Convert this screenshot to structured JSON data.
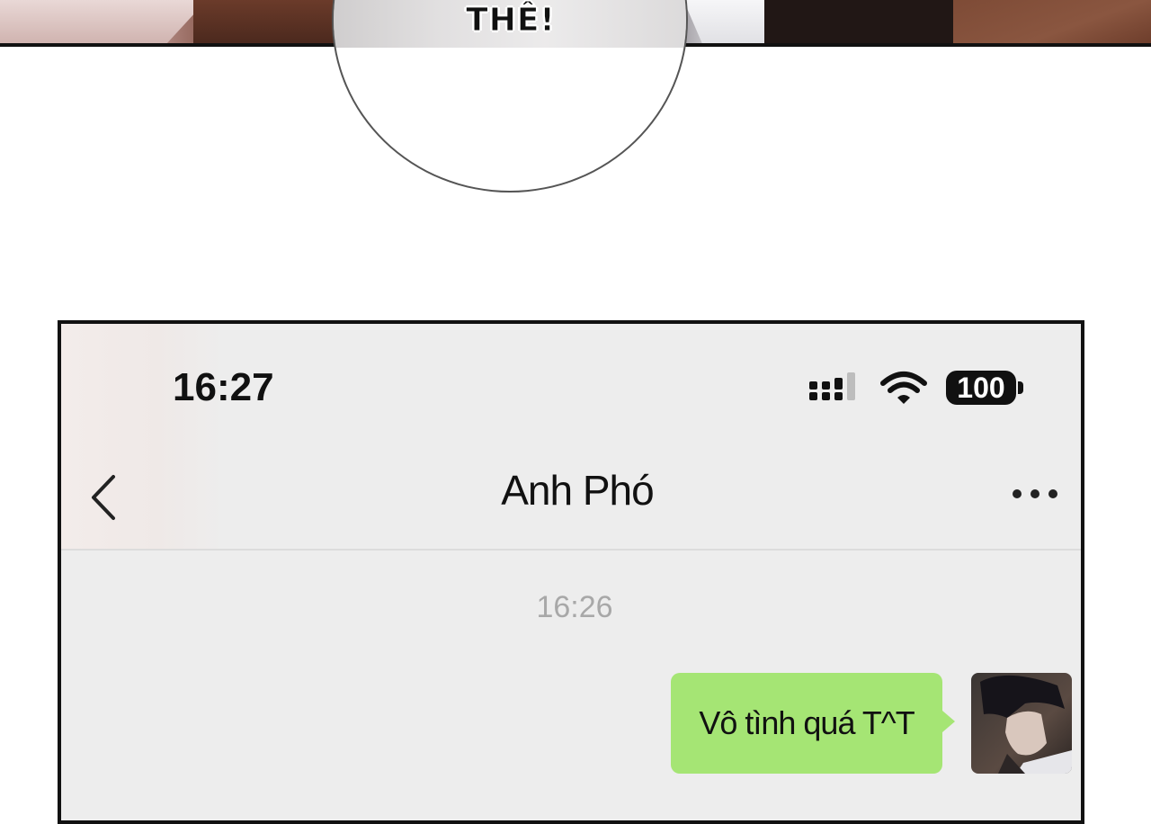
{
  "comic": {
    "speech_text": "THÊ!"
  },
  "phone": {
    "status_bar": {
      "time": "16:27",
      "battery": "100",
      "icons": [
        "signal-icon",
        "wifi-icon",
        "battery-icon"
      ]
    },
    "header": {
      "title": "Anh Phó",
      "back_icon": "chevron-left-icon",
      "more_icon": "more-horizontal-icon"
    },
    "chat": {
      "timestamp": "16:26",
      "messages": [
        {
          "sender": "self",
          "text": "Vô tình quá T^T",
          "bubble_color": "#a5e574"
        }
      ]
    }
  }
}
